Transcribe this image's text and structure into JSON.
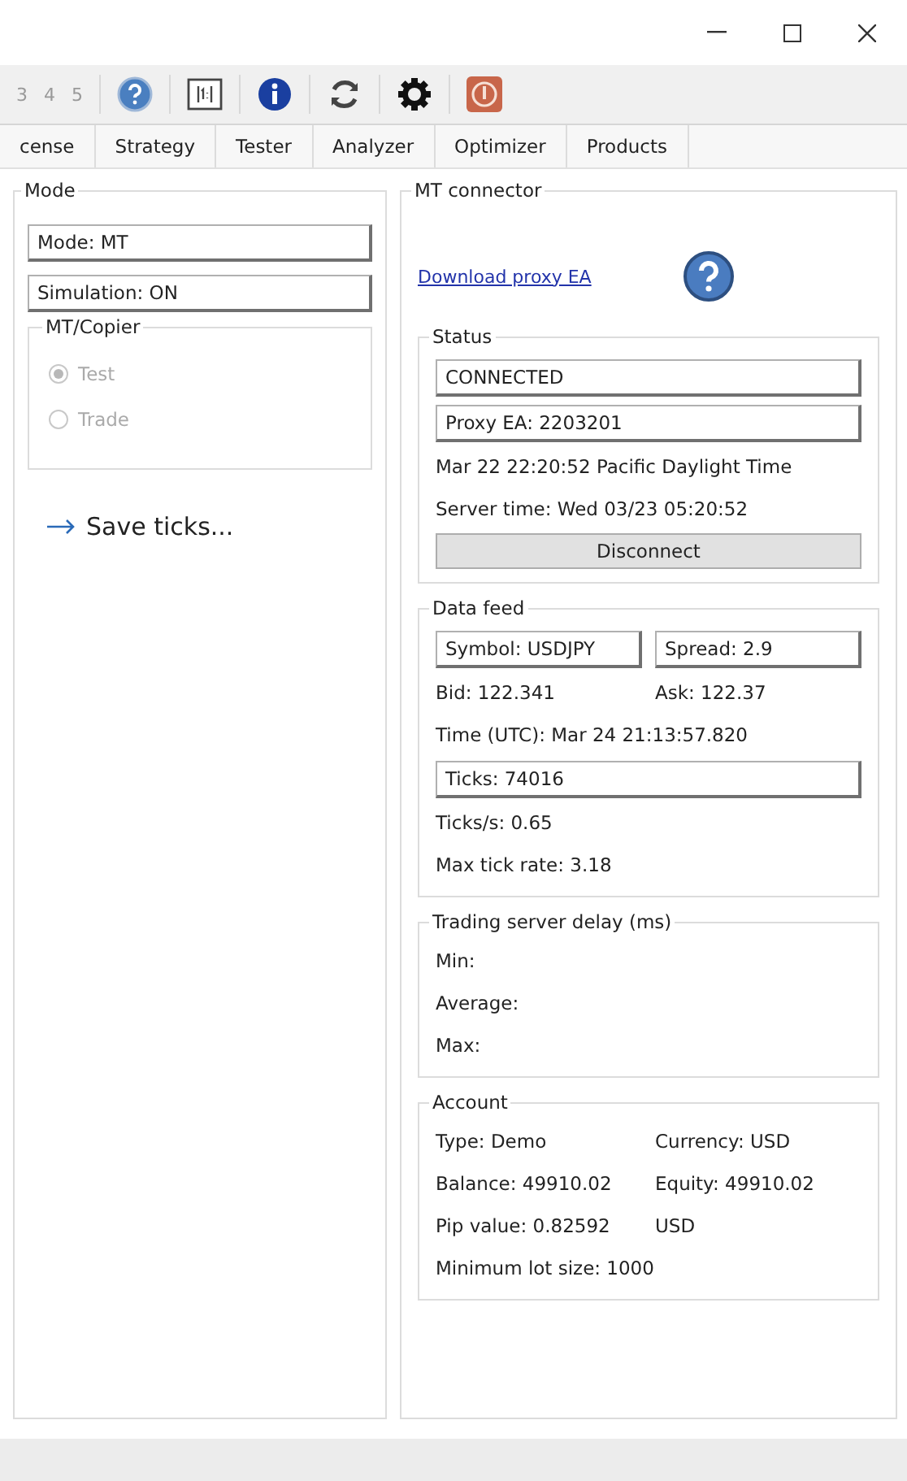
{
  "toolbar": {
    "page_numbers": [
      "3",
      "4",
      "5"
    ]
  },
  "tabs": [
    {
      "label": "cense",
      "selected": false
    },
    {
      "label": "Strategy",
      "selected": false
    },
    {
      "label": "Tester",
      "selected": false
    },
    {
      "label": "Analyzer",
      "selected": false
    },
    {
      "label": "Optimizer",
      "selected": false
    },
    {
      "label": "Products",
      "selected": false
    }
  ],
  "mode_panel": {
    "title": "Mode",
    "fields": [
      "Mode: MT",
      "Simulation: ON"
    ],
    "group": {
      "title": "MT/Copier",
      "disabled": true,
      "options": [
        {
          "label": "Test",
          "selected": true
        },
        {
          "label": "Trade",
          "selected": false
        }
      ]
    },
    "save_link": "Save ticks..."
  },
  "connector_panel": {
    "title": "MT connector",
    "download_link": "Download proxy EA",
    "groups": [
      {
        "title": "Status",
        "rows": [
          {
            "kind": "fields",
            "items": [
              "CONNECTED"
            ]
          },
          {
            "kind": "fields",
            "items": [
              "Proxy EA: 2203201"
            ]
          },
          {
            "kind": "text",
            "items": [
              "Mar 22 22:20:52 Pacific Daylight Time"
            ]
          },
          {
            "kind": "text",
            "items": [
              "Server time: Wed 03/23 05:20:52"
            ]
          },
          {
            "kind": "button",
            "items": [
              "Disconnect"
            ]
          }
        ]
      },
      {
        "title": "Data feed",
        "rows": [
          {
            "kind": "fields",
            "items": [
              "Symbol: USDJPY",
              "Spread: 2.9"
            ]
          },
          {
            "kind": "text",
            "items": [
              "Bid: 122.341",
              "Ask: 122.37"
            ]
          },
          {
            "kind": "text",
            "items": [
              "Time (UTC): Mar 24 21:13:57.820"
            ]
          },
          {
            "kind": "fields",
            "items": [
              "Ticks: 74016"
            ]
          },
          {
            "kind": "text",
            "items": [
              "Ticks/s: 0.65"
            ]
          },
          {
            "kind": "text",
            "items": [
              "Max tick rate: 3.18"
            ]
          }
        ]
      },
      {
        "title": "Trading server delay (ms)",
        "rows": [
          {
            "kind": "text",
            "items": [
              "Min:"
            ]
          },
          {
            "kind": "text",
            "items": [
              "Average:"
            ]
          },
          {
            "kind": "text",
            "items": [
              "Max:"
            ]
          }
        ]
      },
      {
        "title": "Account",
        "rows": [
          {
            "kind": "text",
            "items": [
              "Type: Demo",
              "Currency: USD"
            ]
          },
          {
            "kind": "text",
            "items": [
              "Balance: 49910.02",
              "Equity: 49910.02"
            ]
          },
          {
            "kind": "text",
            "items": [
              "Pip value: 0.82592",
              "USD"
            ]
          },
          {
            "kind": "text",
            "items": [
              "Minimum lot size: 1000"
            ]
          }
        ]
      }
    ]
  }
}
